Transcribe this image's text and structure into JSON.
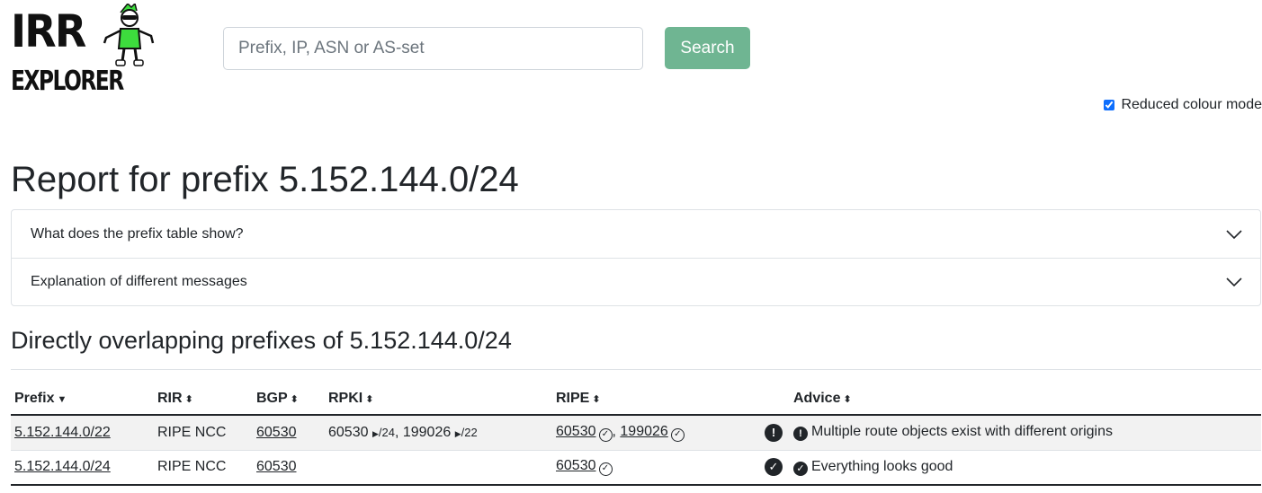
{
  "logo": {
    "line1": "IRR",
    "line2": "EXPLORER"
  },
  "search": {
    "placeholder": "Prefix, IP, ASN or AS-set",
    "button_label": "Search"
  },
  "colour_mode": {
    "label": "Reduced colour mode",
    "checked": true
  },
  "report_title": "Report for prefix 5.152.144.0/24",
  "accordion": [
    {
      "label": "What does the prefix table show?"
    },
    {
      "label": "Explanation of different messages"
    }
  ],
  "section_title": "Directly overlapping prefixes of 5.152.144.0/24",
  "table": {
    "headers": {
      "prefix": "Prefix",
      "rir": "RIR",
      "bgp": "BGP",
      "rpki": "RPKI",
      "ripe": "RIPE",
      "advice": "Advice"
    },
    "rows": [
      {
        "prefix": "5.152.144.0/22",
        "rir": "RIPE NCC",
        "bgp": "60530",
        "rpki": [
          {
            "asn": "60530",
            "len": "/24"
          },
          {
            "asn": "199026",
            "len": "/22"
          }
        ],
        "ripe": [
          "60530",
          "199026"
        ],
        "status": "warning",
        "advice": "Multiple route objects exist with different origins"
      },
      {
        "prefix": "5.152.144.0/24",
        "rir": "RIPE NCC",
        "bgp": "60530",
        "rpki": [],
        "ripe": [
          "60530"
        ],
        "status": "ok",
        "advice": "Everything looks good"
      }
    ]
  },
  "colors": {
    "accent": "#6fb592",
    "text": "#212529",
    "border": "#dee2e6",
    "mascot_green": "#3ddc3d"
  }
}
